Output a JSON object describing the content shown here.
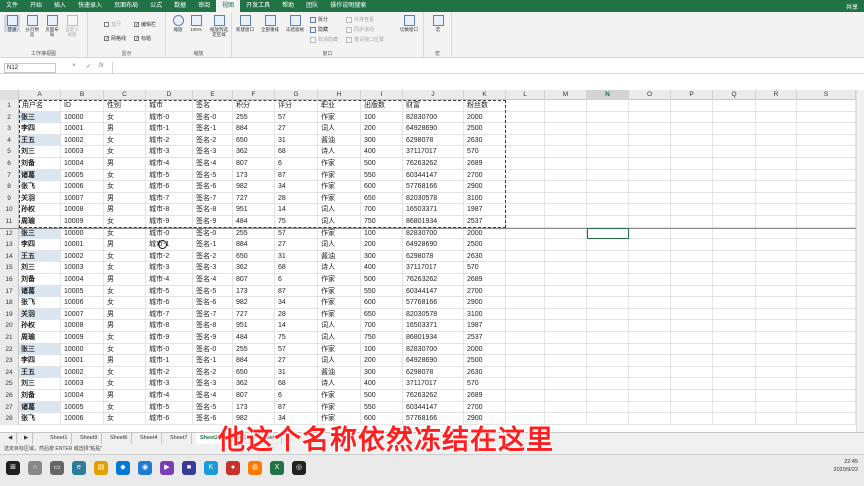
{
  "menu": {
    "tabs": [
      "文件",
      "开始",
      "插入",
      "快速录入",
      "页面布局",
      "公式",
      "数据",
      "审阅",
      "视图",
      "开发工具",
      "帮助",
      "团队",
      "操作说明搜索"
    ],
    "active_index": 8,
    "share": "共享"
  },
  "ribbon": {
    "workbook_views": {
      "label": "工作簿视图",
      "buttons": [
        "普通",
        "分页预览",
        "页面布局",
        "自定义视图"
      ]
    },
    "show": {
      "label": "显示",
      "items": [
        {
          "label": "直尺",
          "checked": false,
          "disabled": true
        },
        {
          "label": "编辑栏",
          "checked": true,
          "disabled": false
        },
        {
          "label": "网格线",
          "checked": true,
          "disabled": false
        },
        {
          "label": "标题",
          "checked": true,
          "disabled": false
        }
      ]
    },
    "zoom": {
      "label": "缩放",
      "buttons": [
        "缩放",
        "100%",
        "缩放到选定区域"
      ]
    },
    "window": {
      "label": "窗口",
      "buttons": [
        "新建窗口",
        "全部重排",
        "冻结窗格"
      ],
      "small": [
        {
          "label": "拆分",
          "disabled": false
        },
        {
          "label": "隐藏",
          "disabled": false
        },
        {
          "label": "取消隐藏",
          "disabled": true
        },
        {
          "label": "并排查看",
          "disabled": true
        },
        {
          "label": "同步滚动",
          "disabled": true
        },
        {
          "label": "重设窗口位置",
          "disabled": true
        }
      ],
      "switch": "切换窗口"
    },
    "macro": {
      "label": "宏",
      "buttons": [
        "宏"
      ]
    }
  },
  "formula_bar": {
    "name_box": "N12",
    "cancel": "×",
    "enter": "✓",
    "fx": "fx",
    "value": ""
  },
  "columns": [
    "A",
    "B",
    "C",
    "D",
    "E",
    "F",
    "G",
    "H",
    "I",
    "J",
    "K",
    "L",
    "M",
    "N",
    "O",
    "P",
    "Q",
    "R",
    "S"
  ],
  "selected_column": "N",
  "headers": [
    "用户名",
    "ID",
    "性别",
    "城市",
    "签名",
    "积分",
    "评分",
    "职业",
    "出版数",
    "财富",
    "粉丝数"
  ],
  "row_numbers": [
    1,
    2,
    3,
    4,
    5,
    6,
    7,
    8,
    9,
    10,
    11,
    12,
    13,
    14,
    15,
    16,
    17,
    18,
    19,
    20,
    21,
    22,
    23,
    24,
    25,
    26,
    27,
    28
  ],
  "visible_rows": [
    [
      "张三",
      "10000",
      "女",
      "城市-0",
      "签名-0",
      "255",
      "57",
      "作家",
      "100",
      "82830700",
      "2000"
    ],
    [
      "李四",
      "10001",
      "男",
      "城市-1",
      "签名-1",
      "884",
      "27",
      "词人",
      "200",
      "64928690",
      "2500"
    ],
    [
      "王五",
      "10002",
      "女",
      "城市-2",
      "签名-2",
      "650",
      "31",
      "酱油",
      "300",
      "6298078",
      "2630"
    ],
    [
      "刘三",
      "10003",
      "女",
      "城市-3",
      "签名-3",
      "362",
      "68",
      "诗人",
      "400",
      "37117017",
      "570"
    ],
    [
      "刘备",
      "10004",
      "男",
      "城市-4",
      "签名-4",
      "807",
      "6",
      "作家",
      "500",
      "76263262",
      "2689"
    ],
    [
      "诸葛",
      "10005",
      "女",
      "城市-5",
      "签名-5",
      "173",
      "87",
      "作家",
      "550",
      "60344147",
      "2700"
    ],
    [
      "张飞",
      "10006",
      "女",
      "城市-6",
      "签名-6",
      "982",
      "34",
      "作家",
      "600",
      "57768166",
      "2900"
    ],
    [
      "关羽",
      "10007",
      "男",
      "城市-7",
      "签名-7",
      "727",
      "28",
      "作家",
      "650",
      "82030578",
      "3100"
    ],
    [
      "孙权",
      "10008",
      "男",
      "城市-8",
      "签名-8",
      "951",
      "14",
      "词人",
      "700",
      "16503371",
      "1987"
    ],
    [
      "周瑜",
      "10009",
      "女",
      "城市-9",
      "签名-9",
      "484",
      "75",
      "词人",
      "750",
      "86801934",
      "2537"
    ],
    [
      "张三",
      "10000",
      "女",
      "城市-0",
      "签名-0",
      "255",
      "57",
      "作家",
      "100",
      "82830700",
      "2000"
    ],
    [
      "李四",
      "10001",
      "男",
      "城市-1",
      "签名-1",
      "884",
      "27",
      "词人",
      "200",
      "64928690",
      "2500"
    ],
    [
      "王五",
      "10002",
      "女",
      "城市-2",
      "签名-2",
      "650",
      "31",
      "酱油",
      "300",
      "6298078",
      "2630"
    ],
    [
      "刘三",
      "10003",
      "女",
      "城市-3",
      "签名-3",
      "362",
      "68",
      "诗人",
      "400",
      "37117017",
      "570"
    ],
    [
      "刘备",
      "10004",
      "男",
      "城市-4",
      "签名-4",
      "807",
      "6",
      "作家",
      "500",
      "76263262",
      "2689"
    ],
    [
      "诸葛",
      "10005",
      "女",
      "城市-5",
      "签名-5",
      "173",
      "87",
      "作家",
      "550",
      "60344147",
      "2700"
    ],
    [
      "张飞",
      "10006",
      "女",
      "城市-6",
      "签名-6",
      "982",
      "34",
      "作家",
      "600",
      "57768166",
      "2900"
    ],
    [
      "关羽",
      "10007",
      "男",
      "城市-7",
      "签名-7",
      "727",
      "28",
      "作家",
      "650",
      "82030578",
      "3100"
    ],
    [
      "孙权",
      "10008",
      "男",
      "城市-8",
      "签名-8",
      "951",
      "14",
      "词人",
      "700",
      "16503371",
      "1987"
    ],
    [
      "周瑜",
      "10009",
      "女",
      "城市-9",
      "签名-9",
      "484",
      "75",
      "词人",
      "750",
      "86801934",
      "2537"
    ],
    [
      "张三",
      "10000",
      "女",
      "城市-0",
      "签名-0",
      "255",
      "57",
      "作家",
      "100",
      "82830700",
      "2000"
    ],
    [
      "李四",
      "10001",
      "男",
      "城市-1",
      "签名-1",
      "884",
      "27",
      "词人",
      "200",
      "64928690",
      "2500"
    ],
    [
      "王五",
      "10002",
      "女",
      "城市-2",
      "签名-2",
      "650",
      "31",
      "酱油",
      "300",
      "6298078",
      "2630"
    ],
    [
      "刘三",
      "10003",
      "女",
      "城市-3",
      "签名-3",
      "362",
      "68",
      "诗人",
      "400",
      "37117017",
      "570"
    ],
    [
      "刘备",
      "10004",
      "男",
      "城市-4",
      "签名-4",
      "807",
      "6",
      "作家",
      "500",
      "76263262",
      "2689"
    ],
    [
      "诸葛",
      "10005",
      "女",
      "城市-5",
      "签名-5",
      "173",
      "87",
      "作家",
      "550",
      "60344147",
      "2700"
    ],
    [
      "张飞",
      "10006",
      "女",
      "城市-6",
      "签名-6",
      "982",
      "34",
      "作家",
      "600",
      "57768166",
      "2900"
    ]
  ],
  "highlight_name_rows": [
    2,
    4,
    7,
    12,
    14,
    17,
    19,
    22,
    24,
    27
  ],
  "sheet_tabs": [
    "Sheet1",
    "Sheet9",
    "Sheet6",
    "Sheet4",
    "Sheet7",
    "Sheet2",
    "Sheet3",
    "Sheet5"
  ],
  "active_sheet_index": 5,
  "status_text": "选定目标区域，然后按 ENTER 或选择\"粘贴\"",
  "subtitle": "他这个名称依然冻结在这里",
  "clock": {
    "time": "22:45",
    "date": "2020/9/22"
  },
  "zoom_level": "100%"
}
